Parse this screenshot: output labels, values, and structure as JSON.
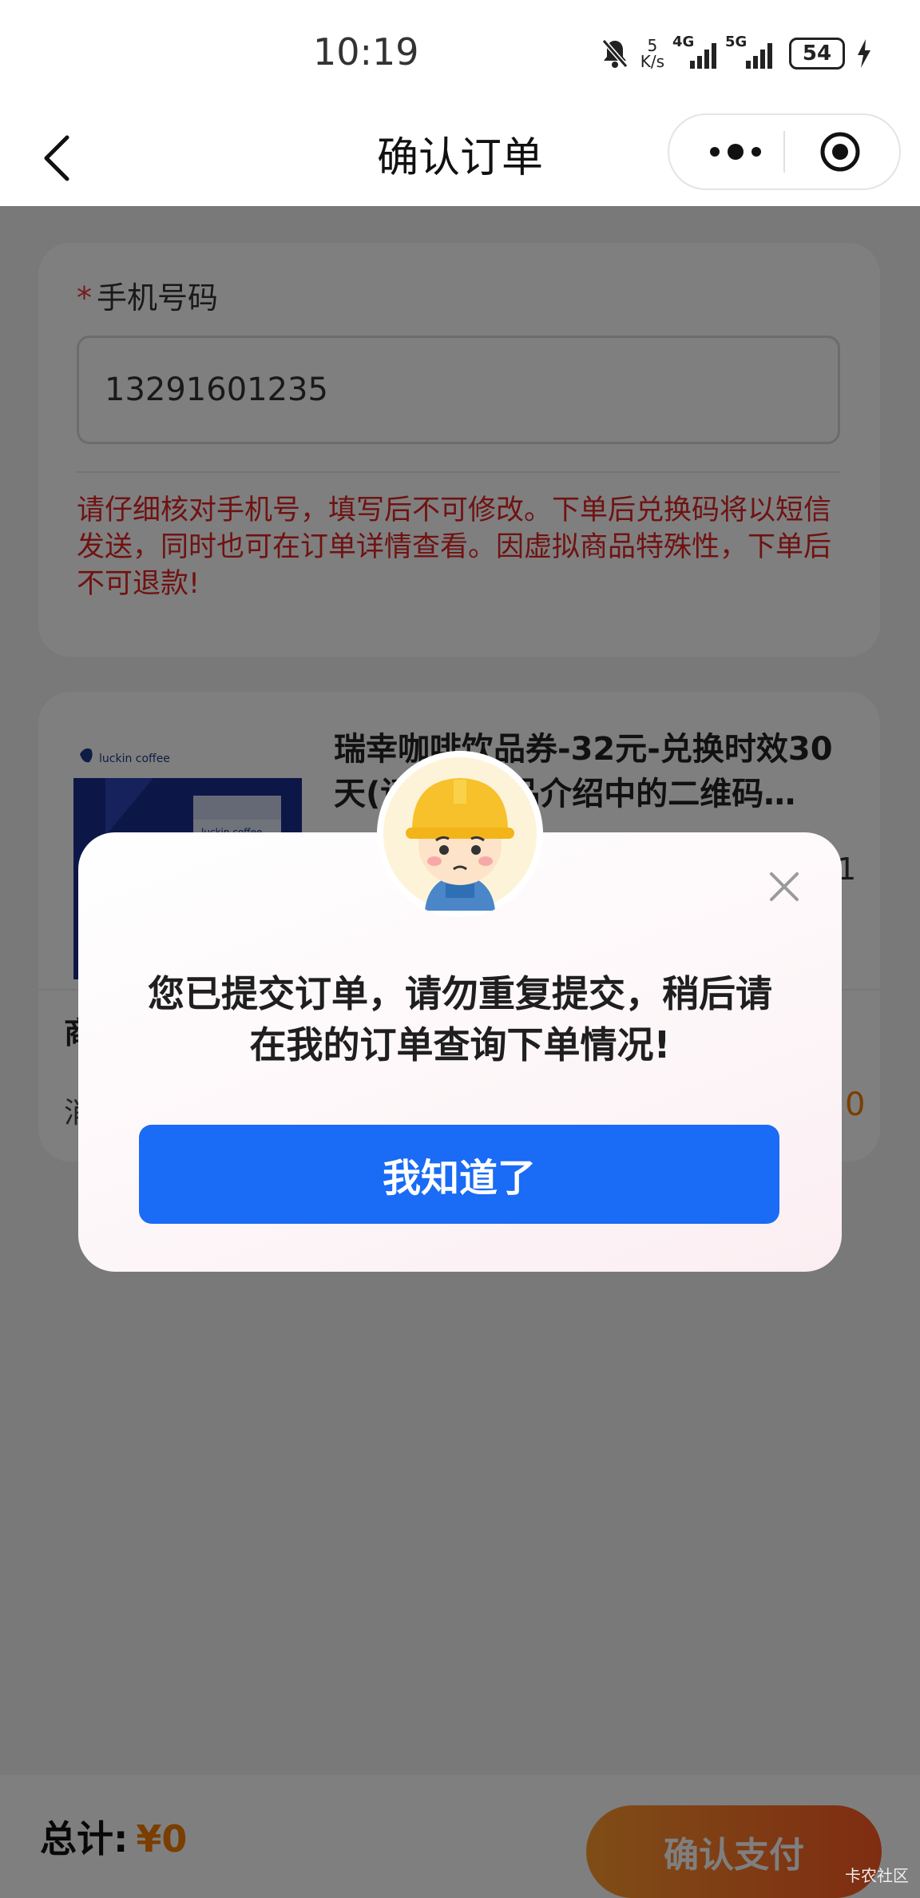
{
  "status_bar": {
    "time": "10:19",
    "net_speed_value": "5",
    "net_speed_unit": "K/s",
    "sim1": "4G",
    "sim2": "5G",
    "battery": "54"
  },
  "nav": {
    "title": "确认订单",
    "back_icon": "chevron-left-icon",
    "more_icon": "more-dots-icon",
    "close_icon": "target-circle-icon"
  },
  "form": {
    "required_mark": "*",
    "phone_label": "手机号码",
    "phone_value": "13291601235",
    "notice": "请仔细核对手机号，填写后不可修改。下单后兑换码将以短信发送，同时也可在订单详情查看。因虚拟商品特殊性，下单后不可退款!"
  },
  "product": {
    "brand_text": "luckin coffee",
    "cup_text": "luckin coffee",
    "title": "瑞幸咖啡饮品券-32元-兑换时效30天(请使用商品介绍中的二维码…",
    "qty": "1",
    "row1_label": "商",
    "row2_label": "消",
    "row2_value": "0"
  },
  "footer": {
    "total_label": "总计:",
    "total_amount": "¥0",
    "pay_button": "确认支付"
  },
  "modal": {
    "message": "您已提交订单，请勿重复提交，稍后请在我的订单查询下单情况!",
    "ok_button": "我知道了"
  },
  "watermark": "卡农社区",
  "colors": {
    "primary_blue": "#1a6bf5",
    "warning_red": "#e02424",
    "accent_orange": "#f57c00"
  }
}
